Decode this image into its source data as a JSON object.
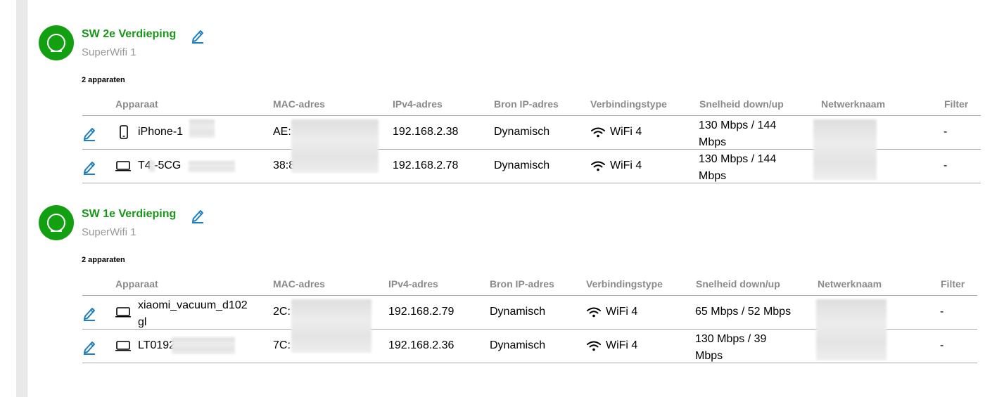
{
  "nodes": [
    {
      "name": "SW 2e Verdieping",
      "type": "SuperWifi 1",
      "count_label": "2 apparaten",
      "headers": [
        "Apparaat",
        "MAC-adres",
        "IPv4-adres",
        "Bron IP-adres",
        "Verbindingstype",
        "Snelheid down/up",
        "Netwerknaam",
        "Filter"
      ],
      "devices": [
        {
          "icon": "phone-icon",
          "name": "iPhone-1",
          "mac": "AE:",
          "ip": "192.168.2.38",
          "source": "Dynamisch",
          "conn": "WiFi 4",
          "speed": "130 Mbps / 144 Mbps",
          "filter": "-"
        },
        {
          "icon": "laptop-icon",
          "name": "T4  -5CG",
          "mac": "38:8",
          "ip": "192.168.2.78",
          "source": "Dynamisch",
          "conn": "WiFi 4",
          "speed": "130 Mbps / 144 Mbps",
          "filter": "-"
        }
      ]
    },
    {
      "name": "SW 1e Verdieping",
      "type": "SuperWifi 1",
      "count_label": "2 apparaten",
      "headers": [
        "Apparaat",
        "MAC-adres",
        "IPv4-adres",
        "Bron IP-adres",
        "Verbindingstype",
        "Snelheid down/up",
        "Netwerknaam",
        "Filter"
      ],
      "devices": [
        {
          "icon": "laptop-icon",
          "name": "xiaomi_vacuum_d102 gl",
          "mac": "2C:",
          "ip": "192.168.2.79",
          "source": "Dynamisch",
          "conn": "WiFi 4",
          "speed": "65 Mbps / 52 Mbps",
          "filter": "-"
        },
        {
          "icon": "laptop-icon",
          "name": "LT0192",
          "mac": "7C:",
          "ip": "192.168.2.36",
          "source": "Dynamisch",
          "conn": "WiFi 4",
          "speed": "130 Mbps / 39 Mbps",
          "filter": "-"
        }
      ]
    }
  ],
  "colors": {
    "accent_green": "#199519",
    "node_green": "#12a012",
    "edit_blue": "#1a7fc1",
    "header_grey": "#8a8a8a"
  }
}
